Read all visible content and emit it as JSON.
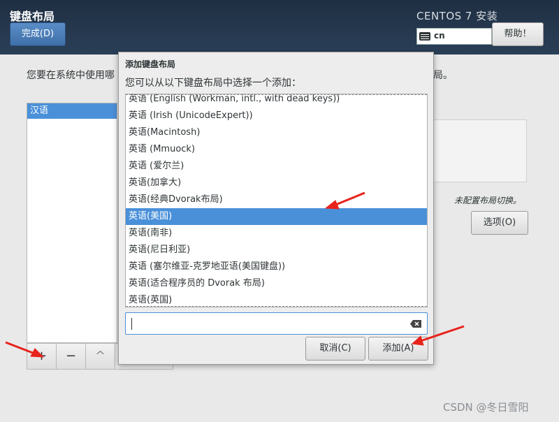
{
  "header": {
    "title": "键盘布局",
    "done_label": "完成(D)",
    "product": "CENTOS 7 安装",
    "keyboard_indicator": "cn",
    "help_label": "帮助！"
  },
  "background": {
    "description_start": "您要在系统中使用哪",
    "description_end": "局。",
    "layouts": [
      "汉语"
    ],
    "toolbar": {
      "add": "+",
      "remove": "−",
      "up": "^"
    },
    "switch_note": "未配置布局切换。",
    "options_label": "选项(O)"
  },
  "dialog": {
    "title": "添加键盘布局",
    "prompt": "您可以从以下键盘布局中选择一个添加：",
    "items": [
      "英语 (English (Workman, intl., with dead keys))",
      "英语 (Irish (UnicodeExpert))",
      "英语(Macintosh)",
      "英语 (Mmuock)",
      "英语 (爱尔兰)",
      "英语(加拿大)",
      "英语(经典Dvorak布局)",
      "英语(美国)",
      "英语(南非)",
      "英语(尼日利亚)",
      "英语 (塞尔维亚-克罗地亚语(美国键盘))",
      "英语(适合程序员的 Dvorak 布局)",
      "英语(英国)"
    ],
    "selected_index": 7,
    "search_value": "",
    "cancel_label": "取消(C)",
    "add_label": "添加(A)"
  },
  "watermark": "CSDN @冬日雪阳",
  "colors": {
    "accent": "#4a90d9",
    "arrow": "#e8231c",
    "header_bg": "#22344a"
  }
}
